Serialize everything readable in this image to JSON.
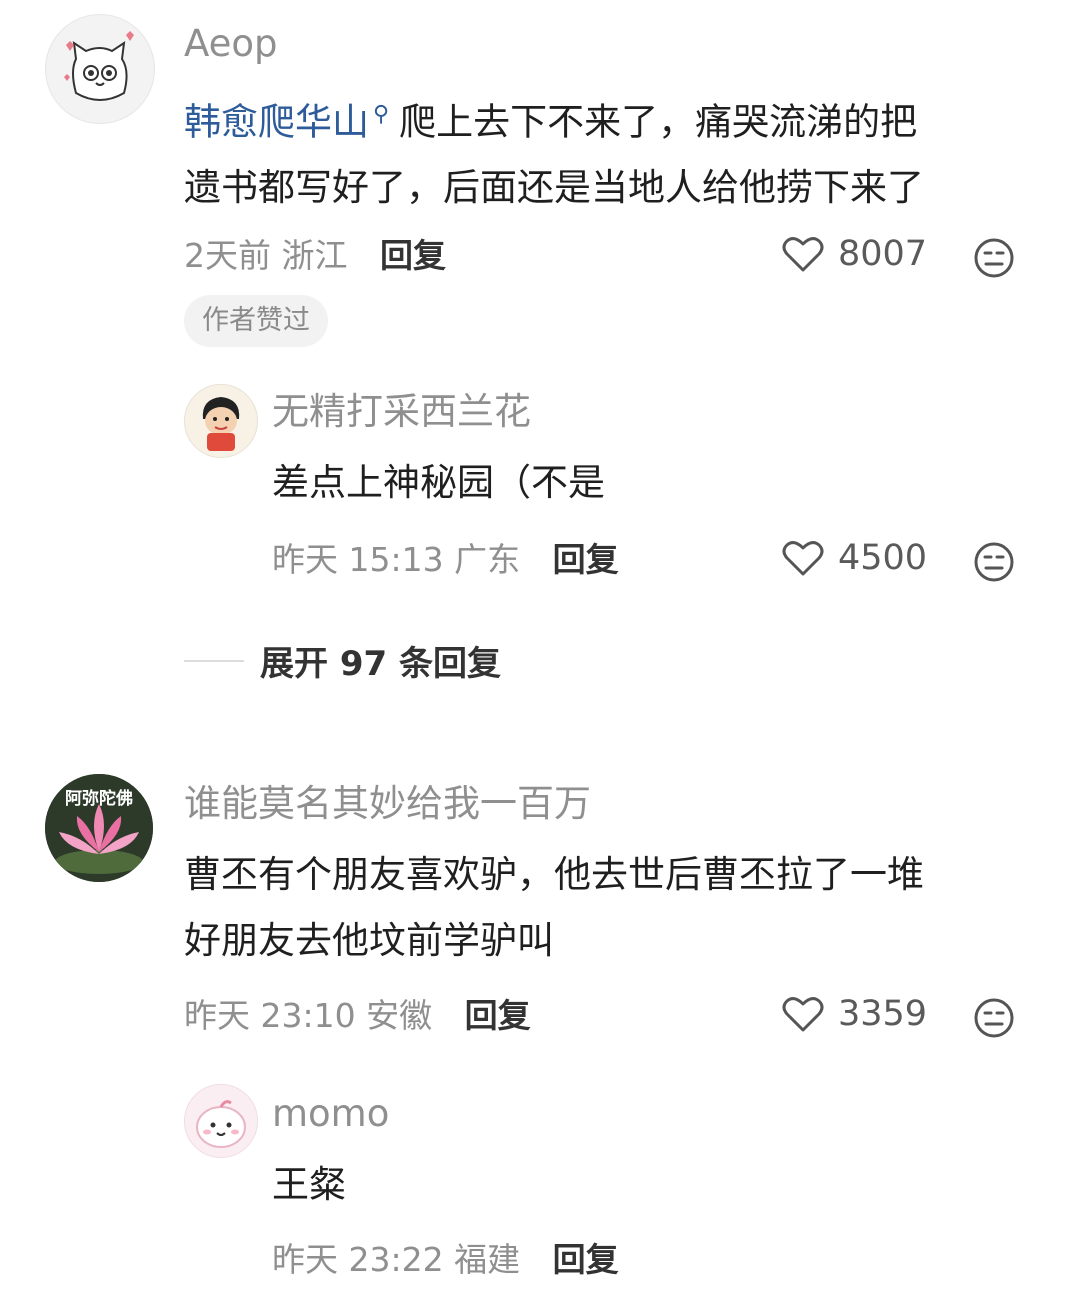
{
  "comments": [
    {
      "user": "Aeop",
      "topic_link": "韩愈爬华山",
      "text_line1": "爬上去下不来了，痛哭流涕的把",
      "text_line2": "遗书都写好了，后面还是当地人给他捞下来了",
      "time": "2天前",
      "location": "浙江",
      "reply_label": "回复",
      "likes": "8007",
      "tag": "作者赞过",
      "replies": [
        {
          "user": "无精打采西兰花",
          "text": "差点上神秘园（不是",
          "time": "昨天 15:13",
          "location": "广东",
          "reply_label": "回复",
          "likes": "4500"
        }
      ],
      "expand_label": "展开 97 条回复"
    },
    {
      "user": "谁能莫名其妙给我一百万",
      "avatar_text": "阿弥陀佛",
      "text_line1": "曹丕有个朋友喜欢驴，他去世后曹丕拉了一堆",
      "text_line2": "好朋友去他坟前学驴叫",
      "time": "昨天 23:10",
      "location": "安徽",
      "reply_label": "回复",
      "likes": "3359",
      "replies": [
        {
          "user": "momo",
          "text": "王粲",
          "time": "昨天 23:22",
          "location": "福建",
          "reply_label": "回复"
        }
      ]
    }
  ],
  "icons": {
    "like": "heart-outline-icon",
    "dislike": "meh-face-icon",
    "search": "search-icon"
  },
  "colors": {
    "topic_link": "#2e5c9a",
    "meta_text": "#8f8f8f"
  }
}
